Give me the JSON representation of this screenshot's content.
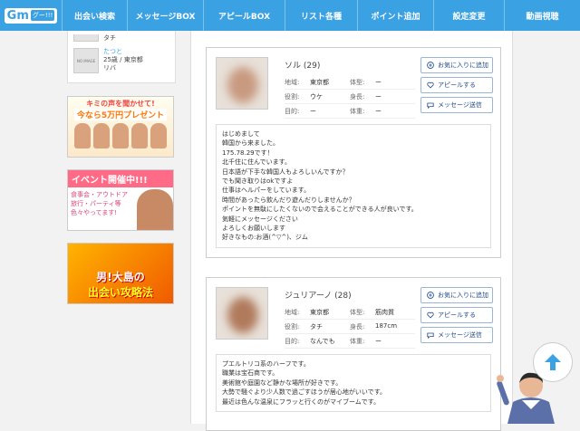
{
  "logo": {
    "mark": "Gm",
    "sub": "グー!!!"
  },
  "nav": [
    {
      "label": "出会い検索"
    },
    {
      "label": "メッセージBOX"
    },
    {
      "label": "アピールBOX"
    },
    {
      "label": "リスト各種"
    },
    {
      "label": "ポイント追加"
    },
    {
      "label": "設定変更"
    },
    {
      "label": "動画視聴"
    }
  ],
  "sidebar": {
    "top_user": {
      "line": "タチ"
    },
    "user": {
      "noimage": "NO IMAGE",
      "name": "たつと",
      "info": "25歳 / 東京都",
      "role": "リバ"
    },
    "banners": [
      {
        "line1": "キミの声を聞かせて!",
        "line2": "今なら5万円プレゼント"
      },
      {
        "head": "イベント開催中!!!",
        "text": "食事会・アウトドア\n旅行・パーティ等\n色々やってます!"
      },
      {
        "line1": "男!大島の",
        "line2": "出会い攻略法"
      }
    ]
  },
  "labels": {
    "region": "地域:",
    "type": "体型:",
    "role": "役割:",
    "height": "身長:",
    "purpose": "目的:",
    "weight": "体重:"
  },
  "buttons": {
    "favorite": "お気に入りに追加",
    "appeal": "アピールする",
    "message": "メッセージ送信"
  },
  "profiles": [
    {
      "name": "ソル (29)",
      "region": "東京都",
      "type": "ー",
      "role": "ウケ",
      "height": "ー",
      "purpose": "ー",
      "weight": "ー",
      "message": "はじめまして\n韓国から来ました。\n175.78.29です！\n北千住に住んでいます。\n日本語が下手な韓国人もよろしいんですか？\nでも聞き取りはokですよ\n仕事はヘルパーをしています。\n時間があったら飲んだり遊んだりしませんか？\nポイントを無駄にしたくないので会えることができる人が良いです。\n気軽にメッセージください\nよろしくお願いします\n好きなもの:お酒(^▽^)、ジム"
    },
    {
      "name": "ジュリアーノ (28)",
      "region": "東京都",
      "type": "筋肉質",
      "role": "タチ",
      "height": "187cm",
      "purpose": "なんでも",
      "weight": "ー",
      "message": "プエルトリコ系のハーフです。\n職業は宝石商です。\n美術館や庭園など静かな場所が好きです。\n大勢で騒ぐより少人数で過ごすほうが居心地がいいです。\n最近は色んな温泉にフラッと行くのがマイブームです。"
    }
  ],
  "colors": {
    "accent": "#3aa1e2",
    "button_text": "#1f4b8a",
    "button_border": "#9bb5d6"
  }
}
